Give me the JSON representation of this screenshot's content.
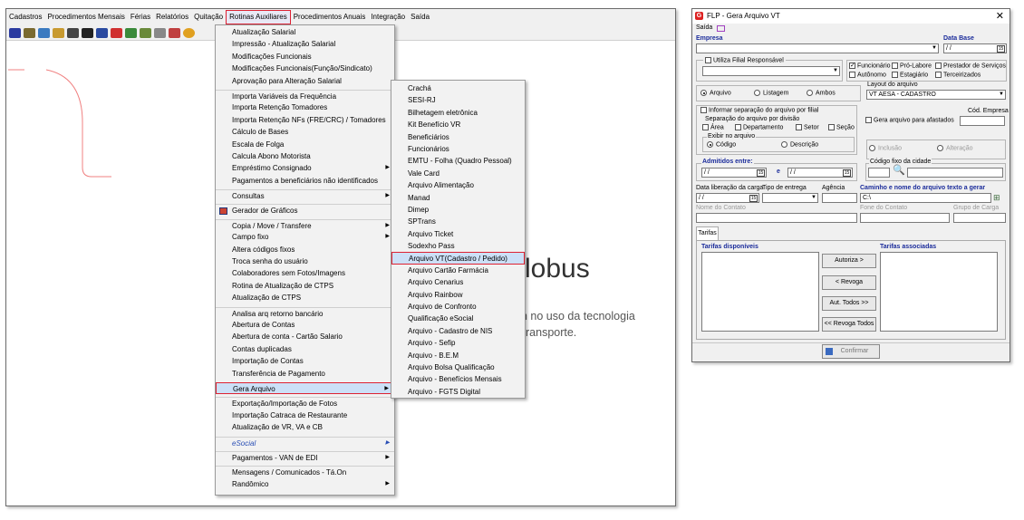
{
  "menubar": {
    "items": [
      "Cadastros",
      "Procedimentos Mensais",
      "Férias",
      "Relatórios",
      "Quitação",
      "Rotinas Auxiliares",
      "Procedimentos Anuais",
      "Integração",
      "Saída"
    ]
  },
  "background": {
    "line1": "lobus",
    "line2": "n no uso da tecnologia",
    "line3": "ransporte."
  },
  "menu_rotinas": {
    "items": [
      {
        "label": "Atualização Salarial"
      },
      {
        "label": "Impressão - Atualização Salarial"
      },
      {
        "label": "Modificações Funcionais"
      },
      {
        "label": "Modificações Funcionais(Função/Sindicato)"
      },
      {
        "label": "Aprovação para Alteração Salarial"
      },
      {
        "label": "Importa Variáveis da Frequência"
      },
      {
        "label": "Importa Retenção Tomadores"
      },
      {
        "label": "Importa Retenção NFs (FRE/CRC) / Tomadores"
      },
      {
        "label": "Cálculo de Bases"
      },
      {
        "label": "Escala de Folga"
      },
      {
        "label": "Calcula Abono Motorista"
      },
      {
        "label": "Empréstimo Consignado"
      },
      {
        "label": "Pagamentos a beneficiários não identificados"
      },
      {
        "label": "Consultas"
      },
      {
        "label": "Gerador de Gráficos"
      },
      {
        "label": "Copia / Move / Transfere"
      },
      {
        "label": "Campo fixo"
      },
      {
        "label": "Altera códigos fixos"
      },
      {
        "label": "Troca senha do usuário"
      },
      {
        "label": "Colaboradores sem Fotos/Imagens"
      },
      {
        "label": "Rotina de Atualização de CTPS"
      },
      {
        "label": "Atualização de CTPS"
      },
      {
        "label": "Analisa arq retorno bancário"
      },
      {
        "label": "Abertura de Contas"
      },
      {
        "label": "Abertura de conta - Cartão Salario"
      },
      {
        "label": "Contas duplicadas"
      },
      {
        "label": "Importação de Contas"
      },
      {
        "label": "Transferência de Pagamento"
      },
      {
        "label": "Gera Arquivo"
      },
      {
        "label": "Exportação/Importação de Fotos"
      },
      {
        "label": "Importação Catraca de Restaurante"
      },
      {
        "label": "Atualização de VR, VA e CB"
      },
      {
        "label": "eSocial"
      },
      {
        "label": "Pagamentos - VAN de EDI"
      },
      {
        "label": "Mensagens / Comunicados - Tá.On"
      },
      {
        "label": "Randômico"
      }
    ]
  },
  "menu_gera_arquivo": {
    "items": [
      "Crachá",
      "SESI-RJ",
      "Bilhetagem eletrônica",
      "Kit Benefício VR",
      "Beneficiários",
      "Funcionários",
      "EMTU - Folha (Quadro Pessoal)",
      "Vale Card",
      "Arquivo Alimentação",
      "Manad",
      "Dimep",
      "SPTrans",
      "Arquivo Ticket",
      "Sodexho Pass",
      "Arquivo VT(Cadastro / Pedido)",
      "Arquivo Cartão Farmácia",
      "Arquivo Cenarius",
      "Arquivo Rainbow",
      "Arquivo de Confronto",
      "Qualificação eSocial",
      "Arquivo - Cadastro de NIS",
      "Arquivo - Sefip",
      "Arquivo - B.E.M",
      "Arquivo Bolsa Qualificação",
      "Arquivo - Benefícios Mensais",
      "Arquivo - FGTS Digital"
    ]
  },
  "dialog": {
    "title": "FLP - Gera Arquivo VT",
    "logo": "G",
    "close": "✕",
    "saida": "Saída",
    "empresa_label": "Empresa",
    "data_base_label": "Data Base",
    "data_base_value": "/ /",
    "utiliza_filial": "Utiliza Filial Responsável",
    "funcionario": "Funcionário",
    "pro_labore": "Pró-Labore",
    "prestador": "Prestador de Serviços",
    "autonomo": "Autônomo",
    "estagiario": "Estagiário",
    "terceirizados": "Terceirizados",
    "arquivo": "Arquivo",
    "listagem": "Listagem",
    "ambos": "Ambos",
    "layout_label": "Layout do arquivo",
    "layout_value": "VT AESA - CADASTRO",
    "informar_sep": "Informar separação do arquivo por filial",
    "sep_divisao": "Separação do arquivo por divisão",
    "area": "Área",
    "departamento": "Departamento",
    "setor": "Setor",
    "secao": "Seção",
    "exibir_label": "Exibir no arquivo",
    "codigo": "Código",
    "descricao": "Descrição",
    "cod_empresa": "Cód. Empresa",
    "gera_afastados": "Gera arquivo para afastados",
    "inclusao": "Inclusão",
    "alteracao": "Alteração",
    "admitidos_label": "Admitidos entre:",
    "admitidos_from": "/ /",
    "admitidos_and": "e",
    "admitidos_to": "/ /",
    "codigo_fixo_label": "Código fixo da cidade",
    "data_lib_label": "Data liberação da carga",
    "data_lib_value": "/ /",
    "tipo_entrega_label": "Tipo de entrega",
    "agencia_label": "Agência",
    "caminho_label": "Caminho e nome do arquivo texto a gerar",
    "caminho_value": "C:\\",
    "nome_contato_label": "Nome do Contato",
    "fone_contato_label": "Fone do Contato",
    "grupo_carga_label": "Grupo de Carga",
    "tab_tarifas": "Tarifas",
    "tarifas_disponiveis": "Tarifas disponíveis",
    "tarifas_associadas": "Tarifas associadas",
    "btn_autoriza": "Autoriza >",
    "btn_revoga": "< Revoga",
    "btn_aut_todos": "Aut. Todos >>",
    "btn_revoga_todos": "<< Revoga Todos",
    "btn_confirmar": "Confirmar"
  }
}
